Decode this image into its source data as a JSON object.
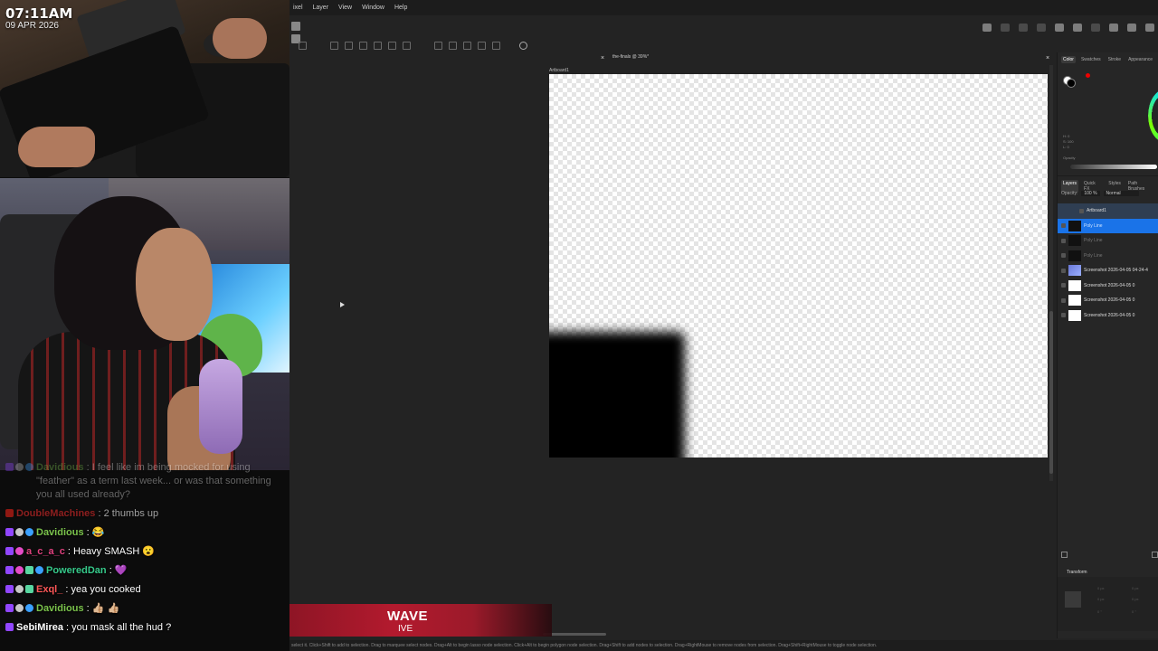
{
  "stream": {
    "clock_time": "07:11AM",
    "clock_date": "09 APR 2026",
    "chat": [
      {
        "user": "Davidious",
        "user_color": "#7bc34c",
        "msg": "I feel like im being mocked for using \"feather\" as a term last week... or was that something you all used already?",
        "faded": "faded"
      },
      {
        "user": "DoubleMachines",
        "user_color": "#e22b2b",
        "msg": "2 thumbs up",
        "faded": "faded2"
      },
      {
        "user": "Davidious",
        "user_color": "#7bc34c",
        "msg": "😂",
        "faded": ""
      },
      {
        "user": "a_c_a_c",
        "user_color": "#e0417f",
        "msg": "Heavy SMASH 😮",
        "faded": ""
      },
      {
        "user": "PoweredDan",
        "user_color": "#36c98a",
        "msg": "💜",
        "faded": ""
      },
      {
        "user": "Exql_",
        "user_color": "#ff5757",
        "msg": "yea you cooked",
        "faded": ""
      },
      {
        "user": "Davidious",
        "user_color": "#7bc34c",
        "msg": "👍🏼 👍🏼",
        "faded": ""
      },
      {
        "user": "SebiMirea",
        "user_color": "#ffffff",
        "msg": "you mask all the hud ?",
        "faded": ""
      }
    ]
  },
  "menubar": {
    "items": [
      "ixel",
      "Layer",
      "View",
      "Window",
      "Help"
    ]
  },
  "document": {
    "tab_left": "×",
    "tab_title": "the-finals @ 39%*",
    "tab_close": "×",
    "artboard_label": "Artboard1"
  },
  "right_panel": {
    "color_tabs": [
      "Color",
      "Swatches",
      "Stroke",
      "Appearance"
    ],
    "color_readout": [
      "H: 0",
      "S: 100",
      "L: 0"
    ],
    "opacity_label": "Opacity",
    "layer_tabs": [
      "Layers",
      "Quick FX",
      "Styles",
      "Path Brushes"
    ],
    "layer_opacity_label": "Opacity:",
    "layer_opacity_value": "100 %",
    "blend_mode": "Normal",
    "layers": [
      {
        "name": "Artboard1",
        "type": "group",
        "thumb": "none"
      },
      {
        "name": "Poly Line",
        "type": "selected",
        "thumb": "black"
      },
      {
        "name": "Poly Line",
        "type": "dim",
        "thumb": "black"
      },
      {
        "name": "Poly Line",
        "type": "dim",
        "thumb": "black"
      },
      {
        "name": "Screenshot 2026-04-05 04-24-4",
        "type": "normal",
        "thumb": "img"
      },
      {
        "name": "Screenshot 2026-04-05 0",
        "type": "normal",
        "thumb": "white"
      },
      {
        "name": "Screenshot 2026-04-05 0",
        "type": "normal",
        "thumb": "white"
      },
      {
        "name": "Screenshot 2026-04-05 0",
        "type": "normal",
        "thumb": "white"
      }
    ],
    "transform_tab": "Transform",
    "transform_values": [
      "0 px",
      "0 px",
      "0 px",
      "0 px",
      "0 °",
      "0 °"
    ]
  },
  "status_bar": "select it. Click+Shift to add to selection. Drag to marquee select nodes. Drag+Alt to begin lasso node selection. Click+Alt to begin polygon node selection. Drag+Shift to add nodes to selection. Drag+RightMouse to remove nodes from selection. Drag+Shift+RightMouse to toggle node selection.",
  "banner": {
    "title": "WAVE",
    "subtitle": "IVE"
  }
}
